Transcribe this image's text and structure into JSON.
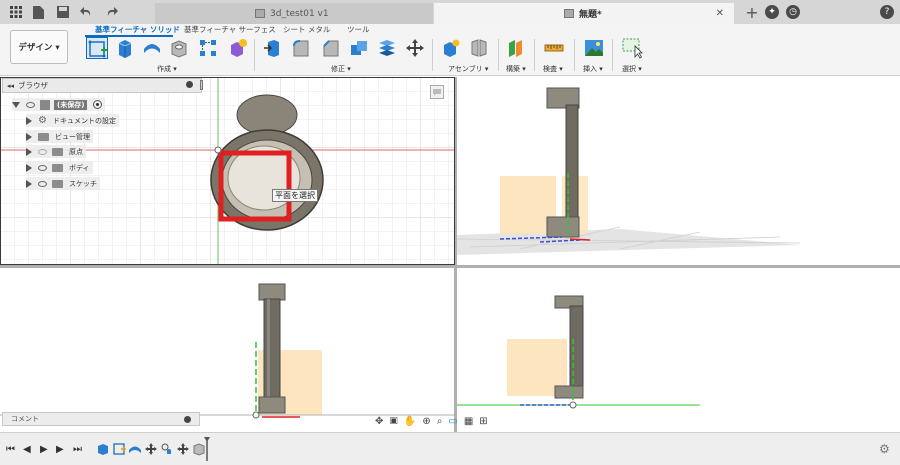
{
  "titlebar": {
    "tabs": [
      {
        "label": "3d_test01 v1",
        "active": false
      },
      {
        "label": "無題*",
        "active": true
      }
    ],
    "icons": [
      "grid-icon",
      "file-icon",
      "save-icon",
      "undo-icon",
      "redo-icon",
      "new-tab-icon",
      "extensions-icon",
      "clock-icon",
      "profile-icon",
      "help-icon"
    ]
  },
  "toolbar": {
    "design_label": "デザイン ▾",
    "ribbon_tabs": [
      {
        "label": "基準フィーチャ ソリッド",
        "active": true
      },
      {
        "label": "基準フィーチャ サーフェス",
        "active": false
      },
      {
        "label": "シート メタル",
        "active": false
      },
      {
        "label": "ツール",
        "active": false
      }
    ],
    "groups": [
      {
        "label": "作成 ▾"
      },
      {
        "label": "修正 ▾"
      },
      {
        "label": "アセンブリ ▾"
      },
      {
        "label": "構築 ▾"
      },
      {
        "label": "検査 ▾"
      },
      {
        "label": "挿入 ▾"
      },
      {
        "label": "選択 ▾"
      }
    ]
  },
  "browser": {
    "title": "ブラウザ",
    "root": "(未保存)",
    "items": [
      {
        "label": "ドキュメントの設定"
      },
      {
        "label": "ビュー管理"
      },
      {
        "label": "原点"
      },
      {
        "label": "ボディ"
      },
      {
        "label": "スケッチ"
      }
    ]
  },
  "viewport": {
    "tooltip": "平面を選択"
  },
  "comments": {
    "label": "コメント"
  },
  "colors": {
    "accent": "#0f6cbd",
    "selection_box": "#e02020",
    "sketch_plane": "#fde2b8",
    "model_dark": "#7a7568",
    "model_light": "#c6c0b2"
  }
}
